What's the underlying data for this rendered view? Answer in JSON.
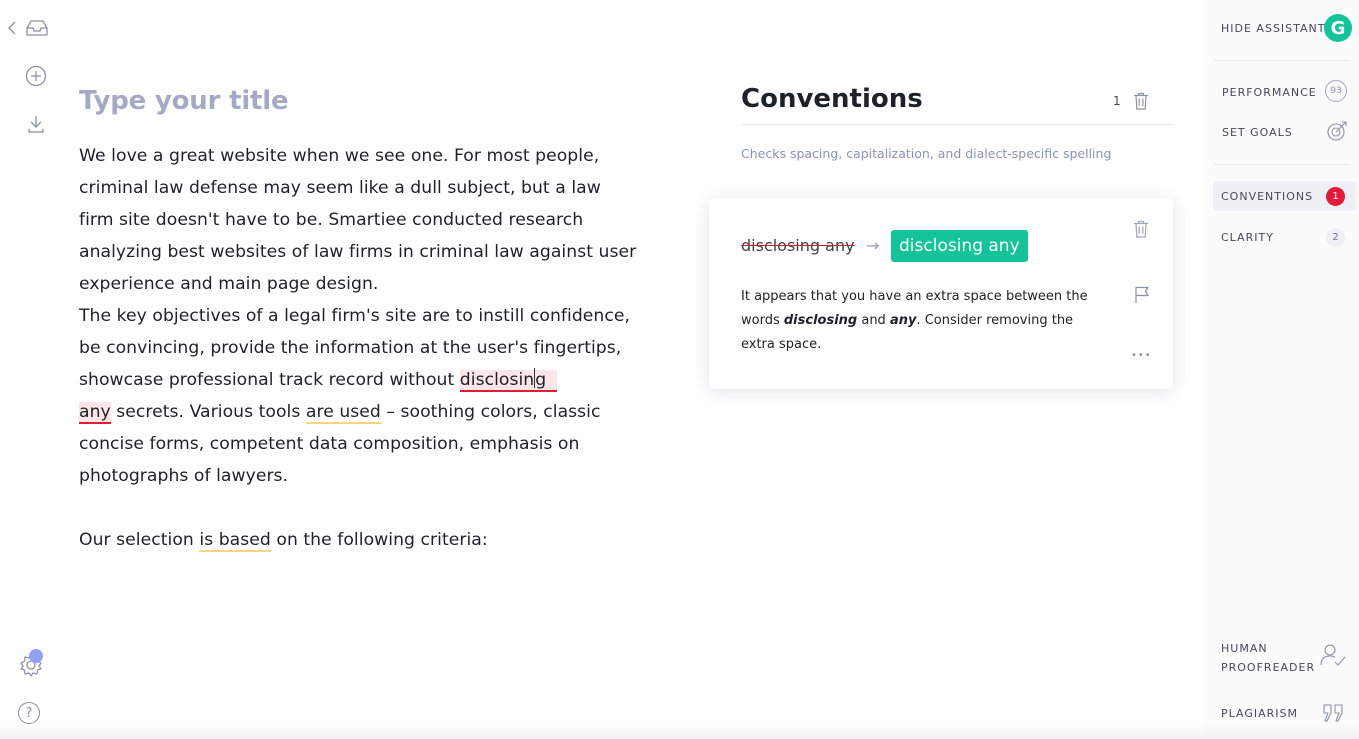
{
  "editor": {
    "title_placeholder": "Type your title",
    "p1": "We love a great website when we see one. For most people, criminal law defense may seem like a dull subject, but a law firm site doesn't have to be. Smartiee conducted research analyzing best websites of law firms in criminal law against user experience and main page design.",
    "p2_a": "The key objectives of a legal firm's site are to instill confidence, be convincing, provide the information at the user's fingertips, showcase professional track record without ",
    "p2_err1a": "disclosin",
    "p2_err1b": "g",
    "p2_err2": "any",
    "p2_b": " secrets. Various tools ",
    "p2_warn1": "are used",
    "p2_c": " – soothing colors, classic concise forms, competent data composition, emphasis on photographs of lawyers.",
    "p3_a": "Our selection ",
    "p3_warn": "is based",
    "p3_b": " on the following criteria:"
  },
  "panel": {
    "title": "Conventions",
    "count": "1",
    "subtitle": "Checks spacing, capitalization, and dialect-specific spelling"
  },
  "card": {
    "original": "disclosing any",
    "arrow": "→",
    "replacement": "disclosing any",
    "explain_a": "It appears that you have an extra space between the words ",
    "explain_w1": "disclosing",
    "explain_b": " and ",
    "explain_w2": "any",
    "explain_c": ". Consider removing the extra space.",
    "more": "•••"
  },
  "sidebar": {
    "hide_assistant": "HIDE ASSISTANT",
    "logo_letter": "G",
    "performance": "PERFORMANCE",
    "performance_score": "93",
    "set_goals": "SET GOALS",
    "conventions": "CONVENTIONS",
    "conventions_count": "1",
    "clarity": "CLARITY",
    "clarity_count": "2",
    "human_proofreader_1": "HUMAN",
    "human_proofreader_2": "PROOFREADER",
    "plagiarism": "PLAGIARISM"
  },
  "left_rail": {
    "help": "?",
    "icons": [
      "back-chevron-icon",
      "inbox-icon",
      "add-document-icon",
      "download-icon",
      "settings-icon",
      "help-icon"
    ]
  },
  "colors": {
    "brand_green": "#15c39a",
    "error_red": "#e31b3a",
    "warning_yellow": "#f8d67c",
    "title_placeholder": "#a4aac6"
  }
}
